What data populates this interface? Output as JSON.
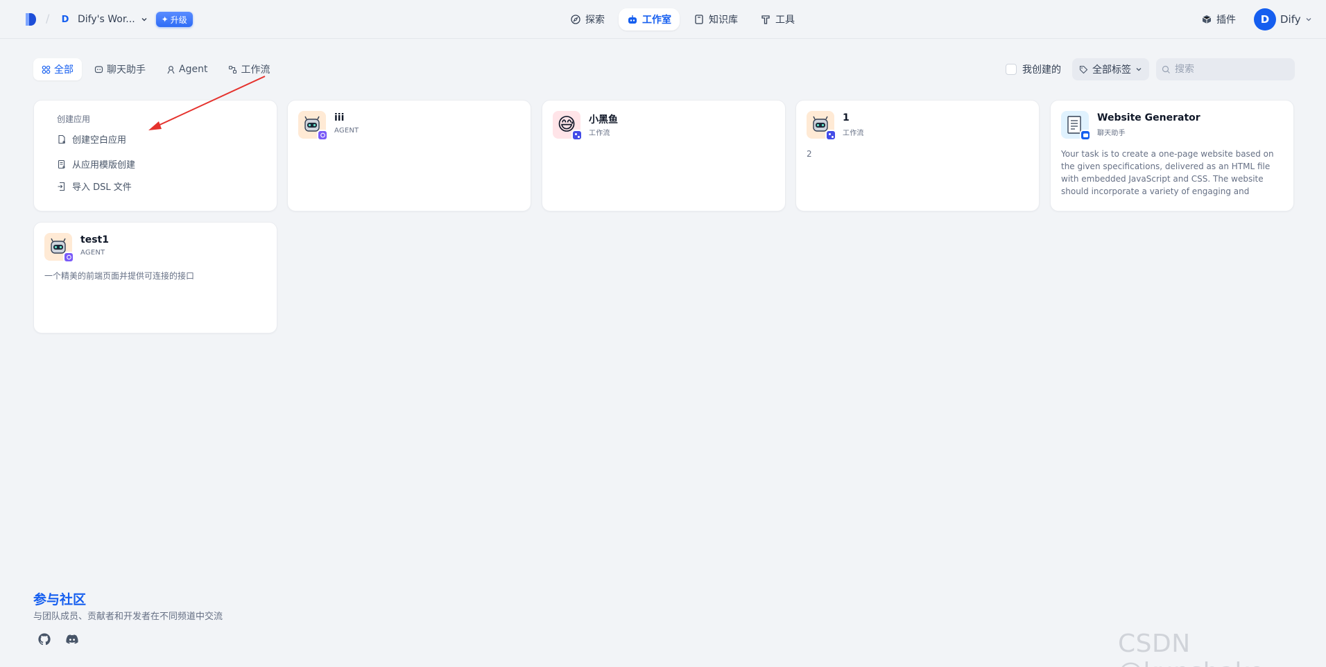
{
  "header": {
    "workspace_avatar": "D",
    "workspace_name": "Dify's Wor...",
    "upgrade_label": "升级",
    "nav": [
      {
        "label": "探索",
        "icon": "compass-icon"
      },
      {
        "label": "工作室",
        "icon": "robot-icon",
        "active": true
      },
      {
        "label": "知识库",
        "icon": "book-icon"
      },
      {
        "label": "工具",
        "icon": "hammer-icon"
      }
    ],
    "plugins_label": "插件",
    "user_avatar": "D",
    "user_name": "Dify"
  },
  "filter": {
    "tabs": [
      {
        "label": "全部",
        "active": true
      },
      {
        "label": "聊天助手"
      },
      {
        "label": "Agent"
      },
      {
        "label": "工作流"
      }
    ],
    "created_by_me_label": "我创建的",
    "tags_label": "全部标签",
    "search_placeholder": "搜索"
  },
  "create": {
    "title": "创建应用",
    "items": [
      "创建空白应用",
      "从应用模版创建",
      "导入 DSL 文件"
    ]
  },
  "apps": [
    {
      "name": "iii",
      "type": "AGENT",
      "desc": ""
    },
    {
      "name": "小黑鱼",
      "type": "工作流",
      "desc": ""
    },
    {
      "name": "1",
      "type": "工作流",
      "desc": "2"
    },
    {
      "name": "Website Generator",
      "type": "聊天助手",
      "desc": "Your task is to create a one-page website based on the given specifications, delivered as an HTML file with embedded JavaScript and CSS. The website should incorporate a variety of engaging and interactive..."
    },
    {
      "name": "test1",
      "type": "AGENT",
      "desc": "一个精美的前端页面并提供可连接的接口"
    }
  ],
  "footer": {
    "title": "参与社区",
    "subtitle": "与团队成员、贡献者和开发者在不同频道中交流"
  },
  "watermark": "CSDN @kunshake",
  "colors": {
    "accent": "#155eef",
    "background": "#f2f4f7",
    "annotation_arrow": "#e5322d"
  }
}
